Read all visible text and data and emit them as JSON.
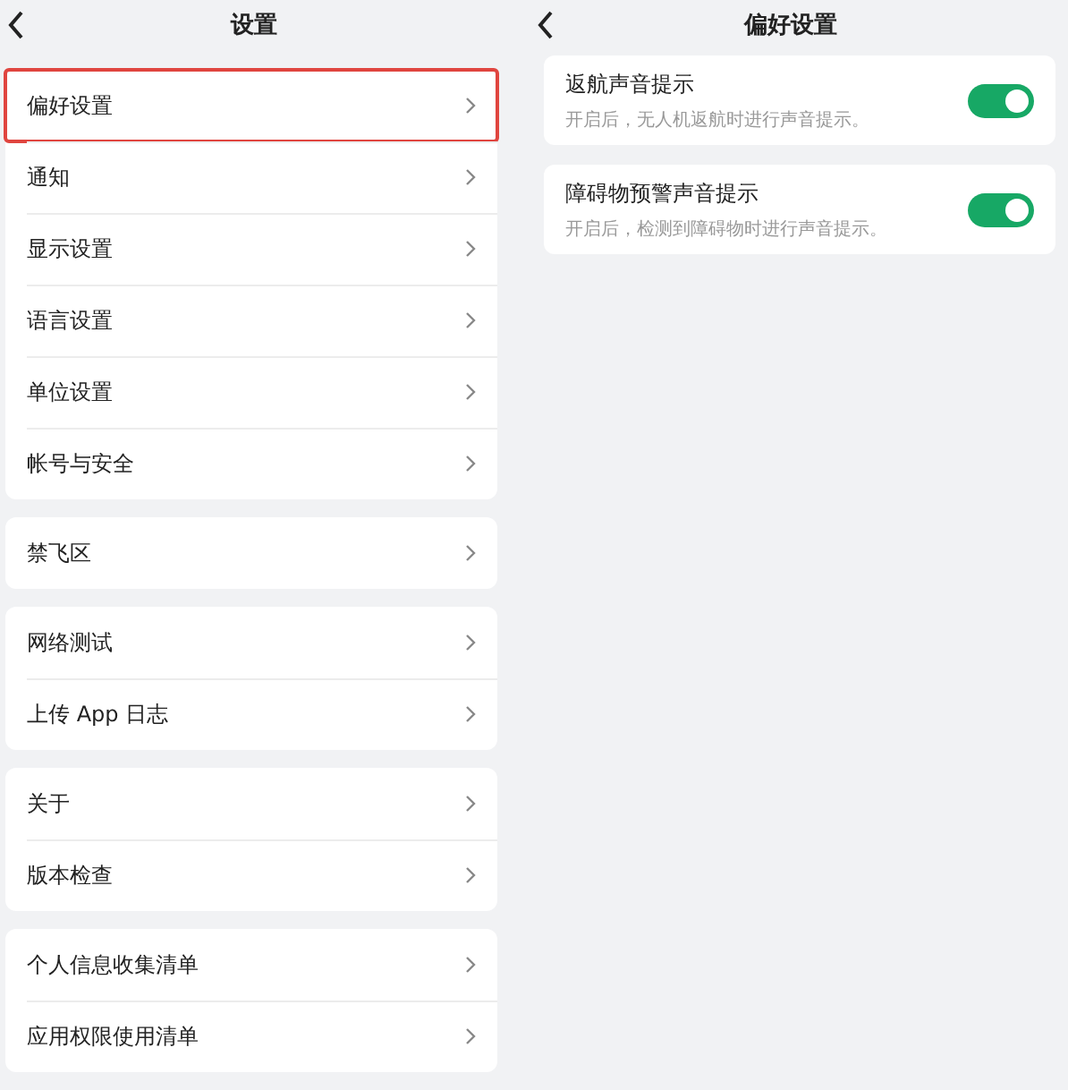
{
  "settings": {
    "title": "设置",
    "groups": [
      {
        "items": [
          {
            "label": "偏好设置",
            "highlighted": true
          },
          {
            "label": "通知",
            "highlighted": false
          },
          {
            "label": "显示设置",
            "highlighted": false
          },
          {
            "label": "语言设置",
            "highlighted": false
          },
          {
            "label": "单位设置",
            "highlighted": false
          },
          {
            "label": "帐号与安全",
            "highlighted": false
          }
        ]
      },
      {
        "items": [
          {
            "label": "禁飞区",
            "highlighted": false
          }
        ]
      },
      {
        "items": [
          {
            "label": "网络测试",
            "highlighted": false
          },
          {
            "label": "上传 App 日志",
            "highlighted": false
          }
        ]
      },
      {
        "items": [
          {
            "label": "关于",
            "highlighted": false
          },
          {
            "label": "版本检查",
            "highlighted": false
          }
        ]
      },
      {
        "items": [
          {
            "label": "个人信息收集清单",
            "highlighted": false
          },
          {
            "label": "应用权限使用清单",
            "highlighted": false
          }
        ]
      }
    ]
  },
  "preferences": {
    "title": "偏好设置",
    "items": [
      {
        "title": "返航声音提示",
        "description": "开启后，无人机返航时进行声音提示。",
        "on": true
      },
      {
        "title": "障碍物预警声音提示",
        "description": "开启后，检测到障碍物时进行声音提示。",
        "on": true
      }
    ]
  }
}
